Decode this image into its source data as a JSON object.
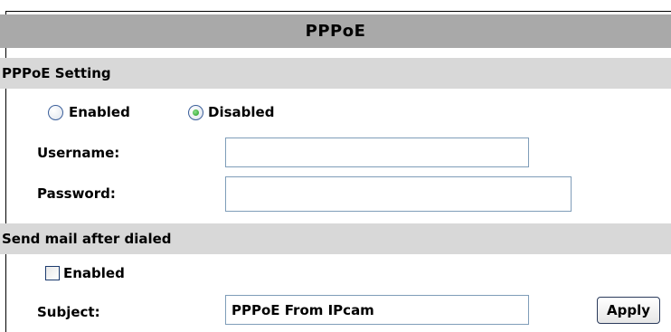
{
  "header": {
    "title": "PPPoE"
  },
  "pppoe_setting": {
    "section_title": "PPPoE Setting",
    "radio_enabled_label": "Enabled",
    "radio_disabled_label": "Disabled",
    "selected": "Disabled",
    "username_label": "Username:",
    "username_value": "",
    "password_label": "Password:",
    "password_value": ""
  },
  "send_mail": {
    "section_title": "Send mail after dialed",
    "enabled_label": "Enabled",
    "enabled_checked": false,
    "subject_label": "Subject:",
    "subject_value": "PPPoE From IPcam",
    "apply_label": "Apply"
  }
}
